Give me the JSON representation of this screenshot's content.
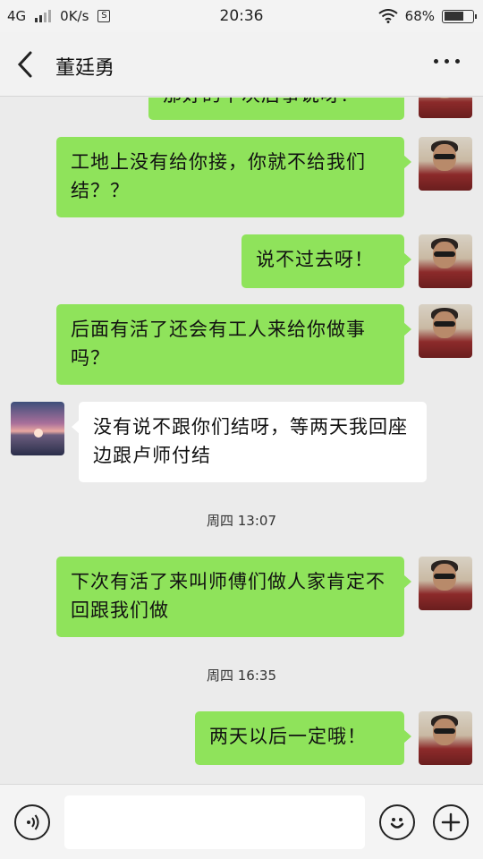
{
  "status_bar": {
    "network": "4G",
    "speed": "0K/s",
    "speed_icon_glyph": "S",
    "time": "20:36",
    "battery": "68%",
    "battery_level": 0.68
  },
  "header": {
    "contact_name": "董廷勇"
  },
  "messages": [
    {
      "side": "me",
      "text": "那好的下次后事说呀！"
    },
    {
      "side": "me",
      "text": "工地上没有给你接，你就不给我们结？？"
    },
    {
      "side": "me",
      "text": "说不过去呀！"
    },
    {
      "side": "me",
      "text": "后面有活了还会有工人来给你做事吗？"
    },
    {
      "side": "other",
      "text": "没有说不跟你们结呀，等两天我回座边跟卢师付结"
    },
    {
      "side": "time",
      "text": "周四 13:07"
    },
    {
      "side": "me",
      "text": "下次有活了来叫师傅们做人家肯定不回跟我们做"
    },
    {
      "side": "time",
      "text": "周四 16:35"
    },
    {
      "side": "me",
      "text": "两天以后一定哦！"
    }
  ],
  "input": {
    "placeholder": ""
  },
  "colors": {
    "my_bubble": "#8fe35b",
    "other_bubble": "#ffffff",
    "background": "#ebebeb"
  },
  "icons": [
    "back-arrow-icon",
    "more-dots-icon",
    "voice-icon",
    "emoji-icon",
    "plus-icon",
    "wifi-icon",
    "battery-icon",
    "signal-icon"
  ]
}
